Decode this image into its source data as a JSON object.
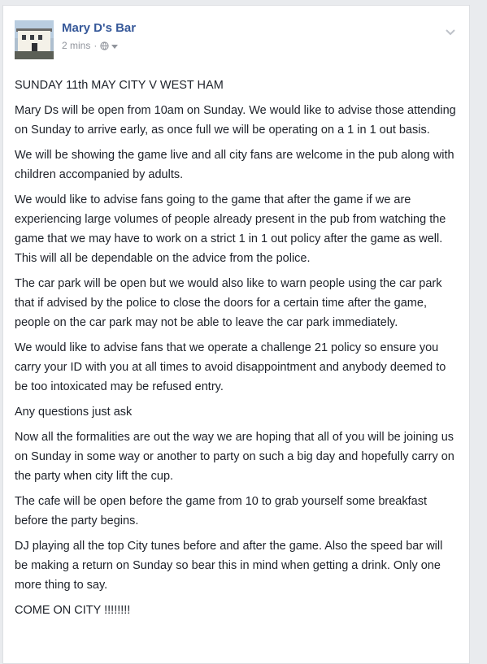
{
  "post": {
    "author": "Mary D's Bar",
    "timestamp": "2 mins",
    "separator": "·",
    "icons": {
      "avatar": "bar-building-photo",
      "audience": "globe-icon",
      "audience_menu": "caret-down-icon",
      "options": "chevron-down-icon"
    },
    "paragraphs": [
      "SUNDAY 11th MAY CITY V WEST HAM",
      "Mary Ds will be open from 10am on Sunday. We would like to advise those attending on Sunday to arrive early, as once full we will be operating on a 1 in 1 out basis.",
      "We will be showing the game live and all city fans are welcome in the pub along with children accompanied by adults.",
      "We would like to advise fans going to the game that after the game if we are experiencing large volumes of people already present in the pub from watching the game that we may have to work on a strict 1 in 1 out policy after the game as well. This will all be dependable on the advice from the police.",
      "The car park will be open but we would also like to warn people using the car park that if advised by the police to close the doors for a certain time after the game, people on the car park may not be able to leave the car park immediately.",
      "We would like to advise fans that we operate a challenge 21 policy so ensure you carry your ID with you at all times to avoid disappointment and anybody deemed to be too intoxicated may be refused entry.",
      "Any questions just ask",
      "Now all the formalities are out the way we are hoping that all of you will be joining us on Sunday in some way or another to party on such a big day and hopefully carry on the party when city lift the cup.",
      "The cafe will be open before the game from 10 to grab yourself some breakfast before the party begins.",
      "DJ playing all the top City tunes before and after the game. Also the speed bar will be making a return on Sunday so bear this in mind when getting a drink. Only one more thing to say.",
      "COME ON CITY !!!!!!!!"
    ]
  },
  "colors": {
    "link": "#365899",
    "meta": "#90949c",
    "text": "#1d2129",
    "background": "#e9ebee"
  }
}
